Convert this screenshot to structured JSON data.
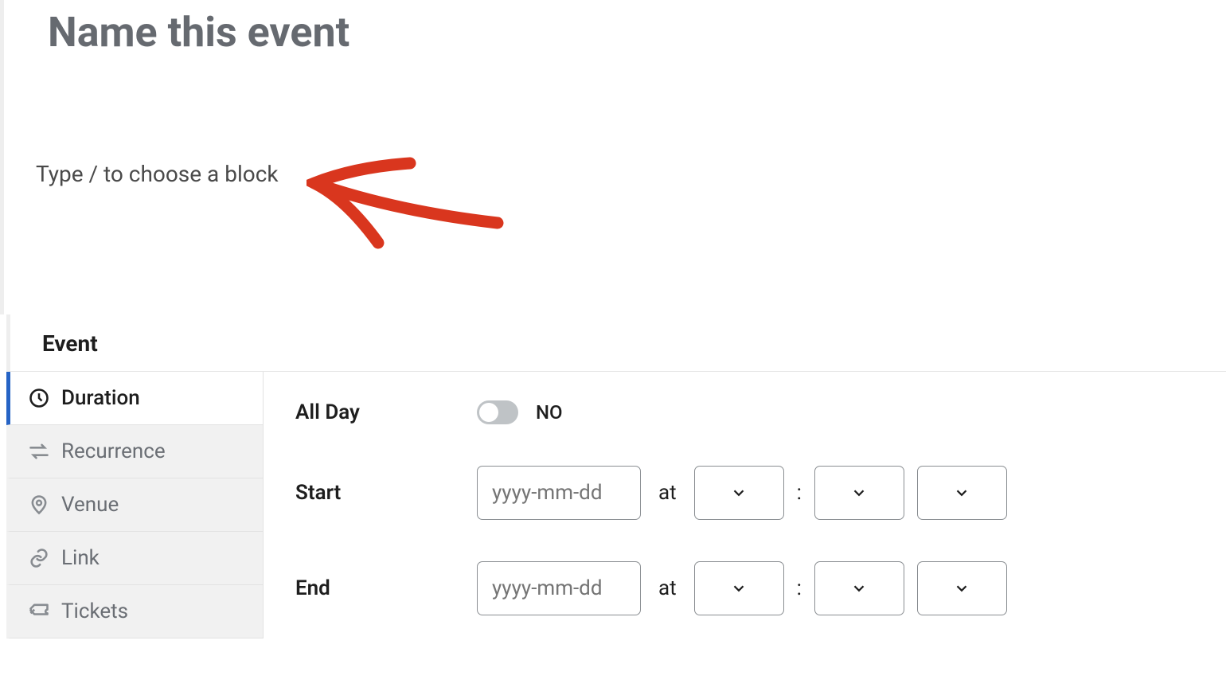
{
  "title_placeholder": "Name this event",
  "block_prompt": "Type / to choose a block",
  "section_heading": "Event",
  "sidebar": {
    "items": [
      {
        "label": "Duration",
        "active": true
      },
      {
        "label": "Recurrence",
        "active": false
      },
      {
        "label": "Venue",
        "active": false
      },
      {
        "label": "Link",
        "active": false
      },
      {
        "label": "Tickets",
        "active": false
      }
    ]
  },
  "duration": {
    "all_day_label": "All Day",
    "all_day_state": "NO",
    "start_label": "Start",
    "end_label": "End",
    "date_placeholder": "yyyy-mm-dd",
    "at_label": "at",
    "colon": ":"
  }
}
